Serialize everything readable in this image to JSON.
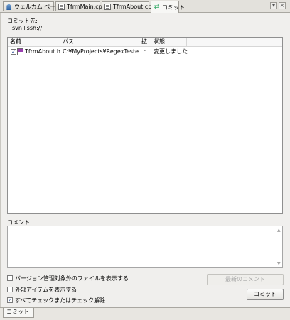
{
  "tabs": [
    {
      "label": "ウェルカム ページ",
      "icon": "home-icon"
    },
    {
      "label": "TfrmMain.cpp",
      "icon": "cpp-file-icon"
    },
    {
      "label": "TfrmAbout.cpp",
      "icon": "cpp-file-icon"
    },
    {
      "label": "コミット",
      "icon": "commit-icon"
    }
  ],
  "commit_target": {
    "label": "コミット先:",
    "value": "svn+ssh://"
  },
  "table": {
    "headers": [
      "名前",
      "パス",
      "拡.",
      "状態"
    ],
    "rows": [
      {
        "checked": true,
        "name": "TfrmAbout.h",
        "path": "C:¥MyProjects¥RegexTester¥",
        "ext": ".h",
        "status": "変更しました"
      }
    ]
  },
  "comment": {
    "label": "コメント",
    "value": ""
  },
  "options": [
    {
      "label": "バージョン管理対象外のファイルを表示する",
      "checked": false
    },
    {
      "label": "外部アイテムを表示する",
      "checked": false
    },
    {
      "label": "すべてチェックまたはチェック解除",
      "checked": true
    }
  ],
  "buttons": {
    "recent_comments": "最新のコメント",
    "commit": "コミット"
  },
  "bottom_tab": "コミット"
}
